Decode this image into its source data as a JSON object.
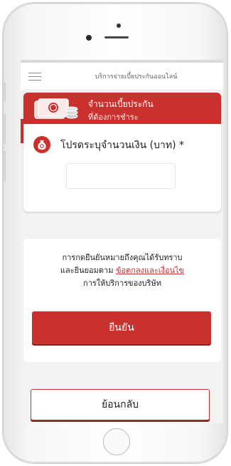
{
  "header": {
    "title": "บริการจ่ายเบี้ยประกันออนไลน์"
  },
  "banner": {
    "line1": "จำนวนเบี้ยประกัน",
    "line2": "ที่ต้องการชำระ"
  },
  "amount": {
    "label": "โปรดระบุจำนวนเงิน (บาท) *",
    "value": "",
    "placeholder": ""
  },
  "consent": {
    "line1": "การกดยืนยันหมายถึงคุณได้รับทราบ",
    "line2_prefix": "และยินยอมตาม",
    "terms_link": "ข้อตกลงและเงื่อนไข",
    "line3": "การให้บริการของบริษัท"
  },
  "buttons": {
    "confirm": "ยืนยัน",
    "back": "ย้อนกลับ"
  },
  "colors": {
    "accent": "#c8312e",
    "background": "#f2f2f2"
  },
  "icons": {
    "menu": "hamburger-icon",
    "banner": "money-icon",
    "amount": "money-bag-icon"
  }
}
